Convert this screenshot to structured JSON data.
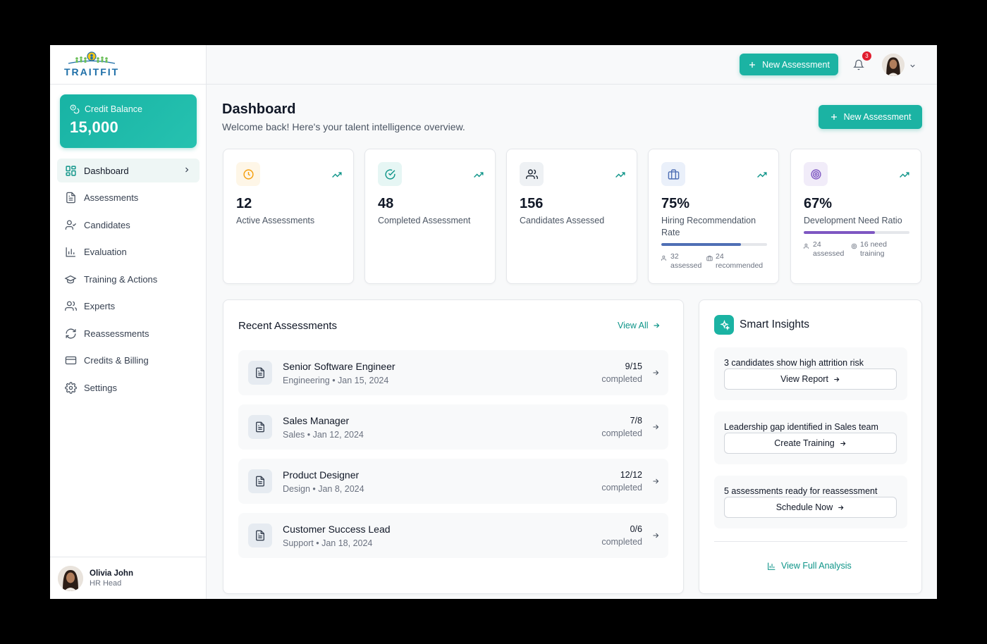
{
  "brand": {
    "logo_text": "TRAITFIT"
  },
  "credit": {
    "label": "Credit Balance",
    "value": "15,000"
  },
  "nav": [
    {
      "label": "Dashboard",
      "icon": "grid-icon",
      "active": true
    },
    {
      "label": "Assessments",
      "icon": "document-icon"
    },
    {
      "label": "Candidates",
      "icon": "user-check-icon"
    },
    {
      "label": "Evaluation",
      "icon": "bar-chart-icon"
    },
    {
      "label": "Training & Actions",
      "icon": "graduation-cap-icon"
    },
    {
      "label": "Experts",
      "icon": "users-icon"
    },
    {
      "label": "Reassessments",
      "icon": "refresh-icon"
    },
    {
      "label": "Credits & Billing",
      "icon": "credit-card-icon"
    },
    {
      "label": "Settings",
      "icon": "gear-icon"
    }
  ],
  "user": {
    "name": "Olivia John",
    "role": "HR Head"
  },
  "topbar": {
    "new_assessment": "New Assessment",
    "notifications": "3"
  },
  "header": {
    "title": "Dashboard",
    "subtitle": "Welcome back! Here's your talent intelligence overview.",
    "new_assessment": "New Assessment"
  },
  "stats": [
    {
      "value": "12",
      "label": "Active Assessments",
      "icon": "clock-icon",
      "color": "#f59e0b",
      "bg": "#fef6e7"
    },
    {
      "value": "48",
      "label": "Completed Assessment",
      "icon": "check-circle-icon",
      "color": "#0d9488",
      "bg": "#e6f6f4"
    },
    {
      "value": "156",
      "label": "Candidates Assessed",
      "icon": "users-icon",
      "color": "#1f2937",
      "bg": "#eef1f4"
    },
    {
      "value": "75%",
      "label": "Hiring Recommendation Rate",
      "icon": "briefcase-icon",
      "color": "#4f6fb5",
      "bg": "#eaf0fa",
      "progress": 75,
      "bar_color": "#4f6fb5",
      "mini": [
        {
          "num": "32",
          "text": "assessed"
        },
        {
          "num": "24",
          "text": "recommended"
        }
      ]
    },
    {
      "value": "67%",
      "label": "Development Need Ratio",
      "icon": "target-icon",
      "color": "#7e57c2",
      "bg": "#f1ecf9",
      "progress": 67,
      "bar_color": "#7e57c2",
      "mini": [
        {
          "num": "24",
          "text": "assessed"
        },
        {
          "num": "16 need",
          "text": "training"
        }
      ]
    }
  ],
  "recent": {
    "title": "Recent Assessments",
    "view_all": "View All",
    "rows": [
      {
        "name": "Senior Software Engineer",
        "meta": "Engineering • Jan 15, 2024",
        "count": "9/15",
        "status": "completed"
      },
      {
        "name": "Sales Manager",
        "meta": "Sales • Jan 12, 2024",
        "count": "7/8",
        "status": "completed"
      },
      {
        "name": "Product Designer",
        "meta": "Design • Jan 8, 2024",
        "count": "12/12",
        "status": "completed"
      },
      {
        "name": "Customer Success Lead",
        "meta": "Support • Jan 18, 2024",
        "count": "0/6",
        "status": "completed"
      }
    ]
  },
  "insights": {
    "title": "Smart Insights",
    "items": [
      {
        "text": "3 candidates show high attrition risk",
        "button": "View Report"
      },
      {
        "text": "Leadership gap identified in Sales team",
        "button": "Create Training"
      },
      {
        "text": "5 assessments ready for reassessment",
        "button": "Schedule Now"
      }
    ],
    "full_analysis": "View Full Analysis"
  },
  "colors": {
    "accent": "#1bb3a3",
    "accent_text": "#0d9488"
  }
}
